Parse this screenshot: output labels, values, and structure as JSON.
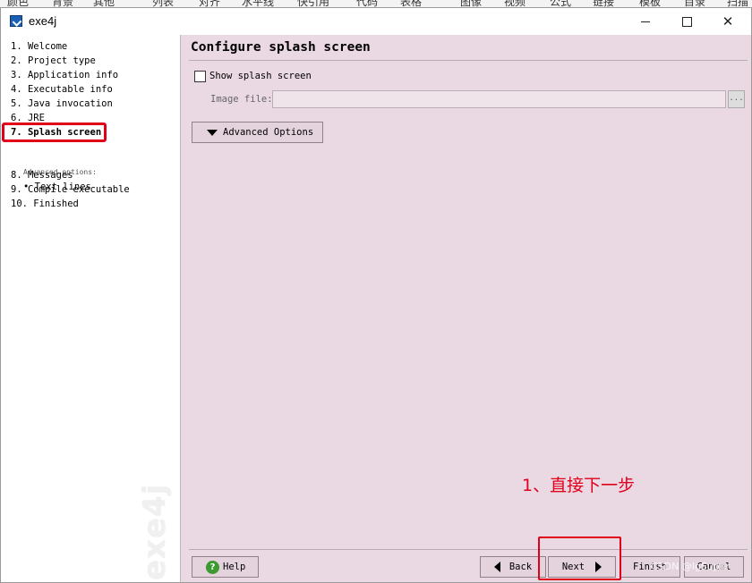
{
  "top_toolbar": {
    "items": [
      "颜色",
      "背景",
      "其他",
      "列表",
      "对齐",
      "水平线",
      "快引用",
      "代码",
      "表格",
      "图像",
      "视频",
      "公式",
      "链接",
      "模板",
      "目录",
      "扫描"
    ]
  },
  "window": {
    "title": "exe4j",
    "controls": {
      "close": "✕"
    }
  },
  "sidebar": {
    "steps": [
      "1. Welcome",
      "2. Project type",
      "3. Application info",
      "4. Executable info",
      "5. Java invocation",
      "6. JRE",
      "7. Splash screen",
      "8. Messages",
      "9. Compile executable",
      "10. Finished"
    ],
    "active_index": 6,
    "advanced_options_label": "Advanced options:",
    "sub_items": [
      "• Text lines"
    ],
    "watermark": "exe4j"
  },
  "main": {
    "title": "Configure splash screen",
    "show_splash": {
      "label": "Show splash screen",
      "checked": false
    },
    "image_file": {
      "label": "Image file:",
      "value": ""
    },
    "browse_label": "...",
    "advanced_button": "Advanced Options"
  },
  "annotation": "1、直接下一步",
  "footer": {
    "help": "Help",
    "help_icon_glyph": "?",
    "back": "Back",
    "next": "Next",
    "finish": "Finish",
    "cancel": "Cancel"
  },
  "watermark_text": "CSDN @lgSuper",
  "colors": {
    "highlight": "#e0001a",
    "panel_bg": "#ead8e3",
    "help_icon": "#3c9a2f"
  }
}
